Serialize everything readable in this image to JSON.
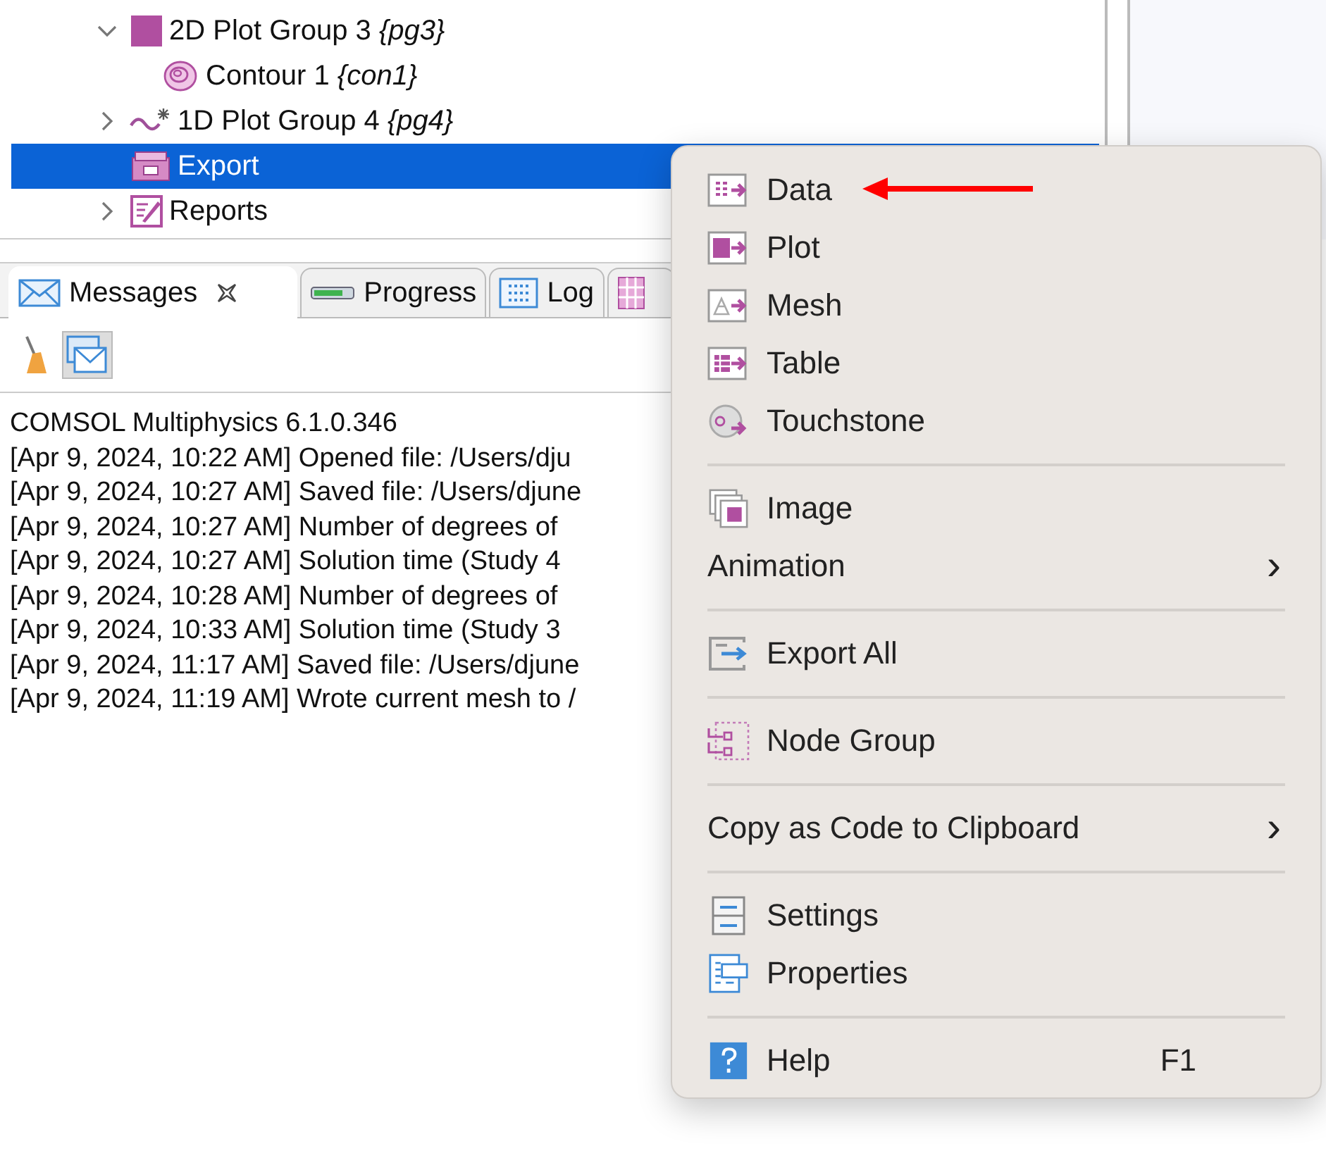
{
  "tree": [
    {
      "label": "2D Plot Group 3 *{pg3}*",
      "expanded": true,
      "selected": false,
      "children": [
        {
          "label": "Contour 1 *{con1}*",
          "selected": false
        }
      ]
    },
    {
      "label": "1D Plot Group 4 *{pg4}*",
      "expanded": false,
      "selected": false
    },
    {
      "label": "Export",
      "selected": true
    },
    {
      "label": "Reports",
      "expanded": false,
      "selected": false
    }
  ],
  "tabs": [
    {
      "label": "Messages",
      "selected": true,
      "closable": true
    },
    {
      "label": "Progress",
      "selected": false,
      "closable": false
    },
    {
      "label": "Log",
      "selected": false,
      "closable": false
    }
  ],
  "toolbar": [
    {
      "kind": "clear",
      "on": false
    },
    {
      "kind": "details",
      "on": true
    }
  ],
  "messages": [
    "COMSOL Multiphysics 6.1.0.346",
    "[Apr 9, 2024, 10:22 AM] Opened file: /Users/dju",
    "[Apr 9, 2024, 10:27 AM] Saved file: /Users/djune",
    "[Apr 9, 2024, 10:27 AM] Number of degrees of",
    "[Apr 9, 2024, 10:27 AM] Solution time (Study 4",
    "[Apr 9, 2024, 10:28 AM] Number of degrees of",
    "[Apr 9, 2024, 10:33 AM] Solution time (Study 3",
    "[Apr 9, 2024, 11:17 AM] Saved file: /Users/djune",
    "[Apr 9, 2024, 11:19 AM] Wrote current mesh to /"
  ],
  "context_menu": [
    {
      "kind": "item",
      "label": "Data"
    },
    {
      "kind": "item",
      "label": "Plot"
    },
    {
      "kind": "item",
      "label": "Mesh"
    },
    {
      "kind": "item",
      "label": "Table"
    },
    {
      "kind": "item",
      "label": "Touchstone"
    },
    {
      "kind": "separator"
    },
    {
      "kind": "item",
      "label": "Image"
    },
    {
      "kind": "submenu",
      "label": "Animation",
      "arrow": "›"
    },
    {
      "kind": "separator"
    },
    {
      "kind": "item",
      "label": "Export All"
    },
    {
      "kind": "separator"
    },
    {
      "kind": "item",
      "label": "Node Group"
    },
    {
      "kind": "separator"
    },
    {
      "kind": "submenu",
      "label": "Copy as Code to Clipboard",
      "arrow": "›"
    },
    {
      "kind": "separator"
    },
    {
      "kind": "item",
      "label": "Settings"
    },
    {
      "kind": "item",
      "label": "Properties"
    },
    {
      "kind": "separator"
    },
    {
      "kind": "item",
      "label": "Help",
      "shortcut": "F1"
    }
  ]
}
